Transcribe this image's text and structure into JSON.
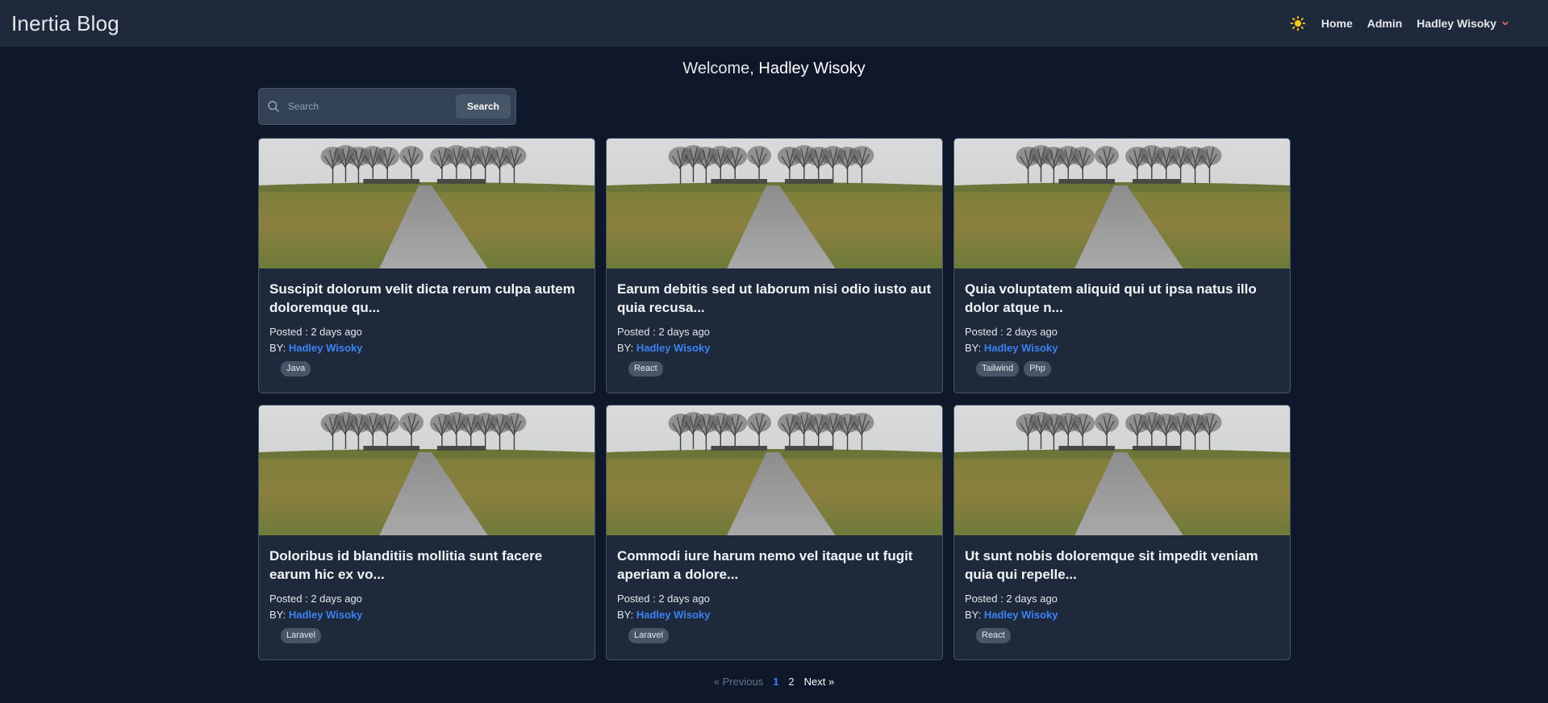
{
  "navbar": {
    "brand": "Inertia Blog",
    "theme_icon": "sun-icon",
    "links": [
      "Home",
      "Admin"
    ],
    "user_name": "Hadley Wisoky"
  },
  "welcome": {
    "prefix": "Welcome, ",
    "name": "Hadley Wisoky"
  },
  "search": {
    "placeholder": "Search",
    "button_label": "Search"
  },
  "posts": [
    {
      "title": "Suscipit dolorum velit dicta rerum culpa autem doloremque qu...",
      "posted_label": "Posted : ",
      "posted": "2 days ago",
      "by_label": "BY: ",
      "author": "Hadley Wisoky",
      "tags": [
        "Java"
      ]
    },
    {
      "title": "Earum debitis sed ut laborum nisi odio iusto aut quia recusa...",
      "posted_label": "Posted : ",
      "posted": "2 days ago",
      "by_label": "BY: ",
      "author": "Hadley Wisoky",
      "tags": [
        "React"
      ]
    },
    {
      "title": "Quia voluptatem aliquid qui ut ipsa natus illo dolor atque n...",
      "posted_label": "Posted : ",
      "posted": "2 days ago",
      "by_label": "BY: ",
      "author": "Hadley Wisoky",
      "tags": [
        "Tailwind",
        "Php"
      ]
    },
    {
      "title": "Doloribus id blanditiis mollitia sunt facere earum hic ex vo...",
      "posted_label": "Posted : ",
      "posted": "2 days ago",
      "by_label": "BY: ",
      "author": "Hadley Wisoky",
      "tags": [
        "Laravel"
      ]
    },
    {
      "title": "Commodi iure harum nemo vel itaque ut fugit aperiam a dolore...",
      "posted_label": "Posted : ",
      "posted": "2 days ago",
      "by_label": "BY: ",
      "author": "Hadley Wisoky",
      "tags": [
        "Laravel"
      ]
    },
    {
      "title": "Ut sunt nobis doloremque sit impedit veniam quia qui repelle...",
      "posted_label": "Posted : ",
      "posted": "2 days ago",
      "by_label": "BY: ",
      "author": "Hadley Wisoky",
      "tags": [
        "React"
      ]
    }
  ],
  "pagination": {
    "prev": "« Previous",
    "pages": [
      "1",
      "2"
    ],
    "active_page": "1",
    "next": "Next »"
  },
  "colors": {
    "background": "#0f172a",
    "surface": "#1e293b",
    "accent": "#3b82f6",
    "sun": "#facc15"
  }
}
